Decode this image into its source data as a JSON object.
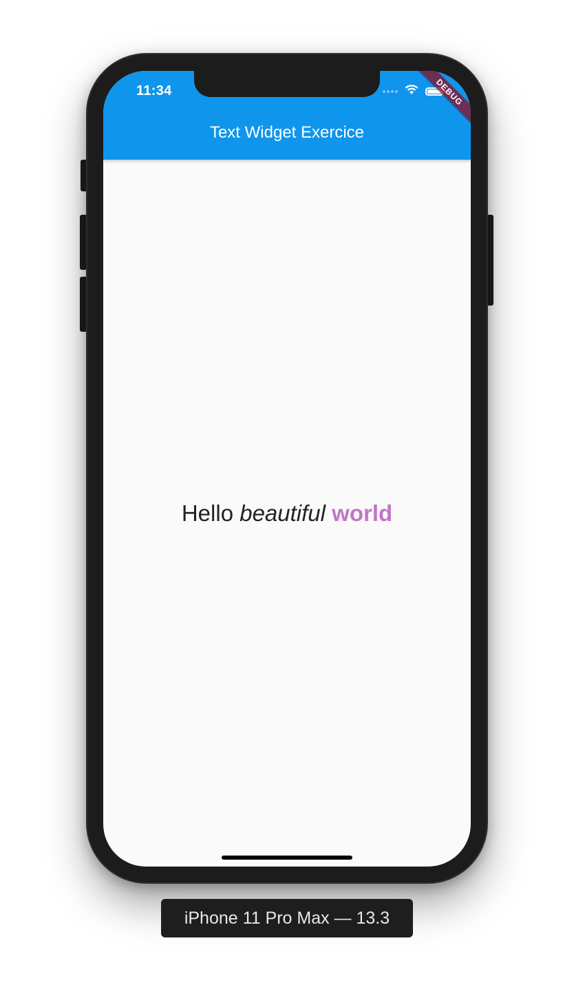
{
  "status_bar": {
    "time": "11:34",
    "icons": [
      "signal-dots-icon",
      "wifi-icon",
      "battery-icon"
    ]
  },
  "debug_banner": "DEBUG",
  "app_bar": {
    "title": "Text Widget Exercice",
    "color": "#0f95ec"
  },
  "body": {
    "text_plain": "Hello",
    "text_italic": "beautiful",
    "text_bold": "world",
    "bold_color": "#c275c7"
  },
  "device_label": "iPhone 11 Pro Max — 13.3"
}
